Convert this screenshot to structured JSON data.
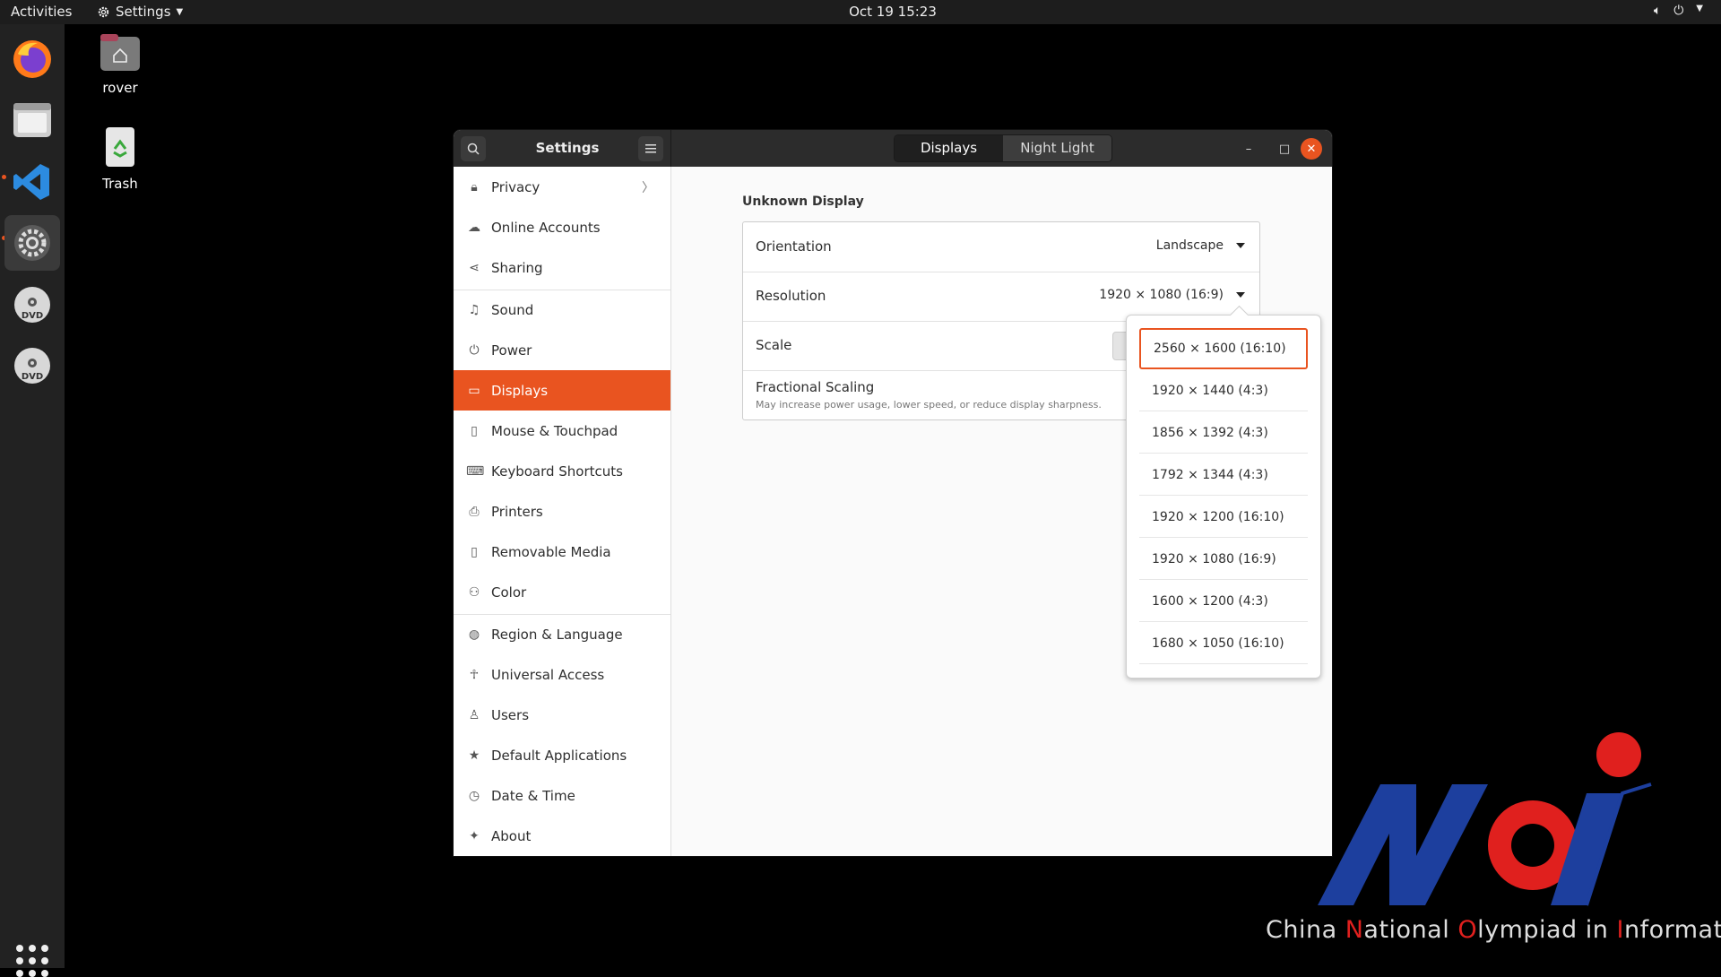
{
  "topbar": {
    "activities": "Activities",
    "app_menu": "Settings",
    "clock": "Oct 19  15:23"
  },
  "desktop": {
    "home_label": "rover",
    "trash_label": "Trash"
  },
  "window": {
    "title": "Settings",
    "tabs": [
      "Displays",
      "Night Light"
    ]
  },
  "sidebar": {
    "items": [
      {
        "label": "Privacy",
        "icon": "lock-icon"
      },
      {
        "label": "Online Accounts",
        "icon": "cloud-icon"
      },
      {
        "label": "Sharing",
        "icon": "share-icon"
      },
      {
        "label": "Sound",
        "icon": "music-note-icon"
      },
      {
        "label": "Power",
        "icon": "power-icon"
      },
      {
        "label": "Displays",
        "icon": "display-icon"
      },
      {
        "label": "Mouse & Touchpad",
        "icon": "mouse-icon"
      },
      {
        "label": "Keyboard Shortcuts",
        "icon": "keyboard-icon"
      },
      {
        "label": "Printers",
        "icon": "printer-icon"
      },
      {
        "label": "Removable Media",
        "icon": "usb-icon"
      },
      {
        "label": "Color",
        "icon": "color-icon"
      },
      {
        "label": "Region & Language",
        "icon": "globe-icon"
      },
      {
        "label": "Universal Access",
        "icon": "accessibility-icon"
      },
      {
        "label": "Users",
        "icon": "user-icon"
      },
      {
        "label": "Default Applications",
        "icon": "star-icon"
      },
      {
        "label": "Date & Time",
        "icon": "clock-icon"
      },
      {
        "label": "About",
        "icon": "sparkle-icon"
      }
    ]
  },
  "display": {
    "section_title": "Unknown Display",
    "orientation_label": "Orientation",
    "orientation_value": "Landscape",
    "resolution_label": "Resolution",
    "resolution_value": "1920 × 1080 (16:9)",
    "scale_label": "Scale",
    "fractional_label": "Fractional Scaling",
    "fractional_sub": "May increase power usage, lower speed, or reduce display sharpness."
  },
  "resolution_options": [
    "2560 × 1600 (16:10)",
    "1920 × 1440 (4:3)",
    "1856 × 1392 (4:3)",
    "1792 × 1344 (4:3)",
    "1920 × 1200 (16:10)",
    "1920 × 1080 (16:9)",
    "1600 × 1200 (4:3)",
    "1680 × 1050 (16:10)"
  ],
  "logo": {
    "parts": [
      {
        "text": "China ",
        "accent": false
      },
      {
        "text": "N",
        "accent": true
      },
      {
        "text": "ational ",
        "accent": false
      },
      {
        "text": "O",
        "accent": true
      },
      {
        "text": "lympiad in ",
        "accent": false
      },
      {
        "text": "I",
        "accent": true
      },
      {
        "text": "nformatics",
        "accent": false
      }
    ]
  },
  "colors": {
    "accent": "#e95420",
    "logo_blue": "#1d3f9e",
    "logo_red": "#e0201e"
  }
}
